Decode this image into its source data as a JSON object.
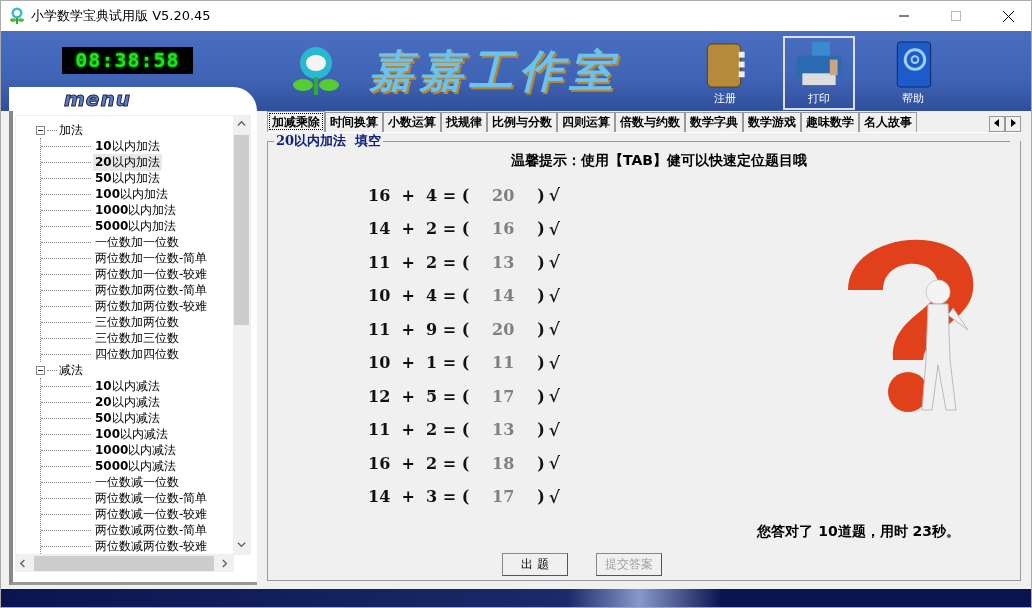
{
  "window": {
    "title": "小学数学宝典试用版  V5.20.45"
  },
  "header": {
    "clock": "08:38:58",
    "logo_text": "嘉嘉工作室",
    "toolbar": [
      {
        "label": "注册",
        "kind": "notebook",
        "selected": false
      },
      {
        "label": "打印",
        "kind": "printer",
        "selected": true
      },
      {
        "label": "帮助",
        "kind": "addressbook",
        "selected": false
      }
    ]
  },
  "sidebar": {
    "title": "menu",
    "tree": [
      {
        "label": "加法",
        "expanded": true,
        "children": [
          {
            "label": "**10**以内加法",
            "selected": false
          },
          {
            "label": "**20**以内加法",
            "selected": true
          },
          {
            "label": "**50**以内加法",
            "selected": false
          },
          {
            "label": "**100**以内加法",
            "selected": false
          },
          {
            "label": "**1000**以内加法",
            "selected": false
          },
          {
            "label": "**5000**以内加法",
            "selected": false
          },
          {
            "label": "一位数加一位数",
            "selected": false
          },
          {
            "label": "两位数加一位数-简单",
            "selected": false
          },
          {
            "label": "两位数加一位数-较难",
            "selected": false
          },
          {
            "label": "两位数加两位数-简单",
            "selected": false
          },
          {
            "label": "两位数加两位数-较难",
            "selected": false
          },
          {
            "label": "三位数加两位数",
            "selected": false
          },
          {
            "label": "三位数加三位数",
            "selected": false
          },
          {
            "label": "四位数加四位数",
            "selected": false
          }
        ]
      },
      {
        "label": "减法",
        "expanded": true,
        "children": [
          {
            "label": "**10**以内减法",
            "selected": false
          },
          {
            "label": "**20**以内减法",
            "selected": false
          },
          {
            "label": "**50**以内减法",
            "selected": false
          },
          {
            "label": "**100**以内减法",
            "selected": false
          },
          {
            "label": "**1000**以内减法",
            "selected": false
          },
          {
            "label": "**5000**以内减法",
            "selected": false
          },
          {
            "label": "一位数减一位数",
            "selected": false
          },
          {
            "label": "两位数减一位数-简单",
            "selected": false
          },
          {
            "label": "两位数减一位数-较难",
            "selected": false
          },
          {
            "label": "两位数减两位数-简单",
            "selected": false
          },
          {
            "label": "两位数减两位数-较难",
            "selected": false
          }
        ]
      }
    ]
  },
  "tabs": [
    {
      "label": "加减乘除",
      "selected": true
    },
    {
      "label": "时间换算",
      "selected": false
    },
    {
      "label": "小数运算",
      "selected": false
    },
    {
      "label": "找规律",
      "selected": false
    },
    {
      "label": "比例与分数",
      "selected": false
    },
    {
      "label": "四则运算",
      "selected": false
    },
    {
      "label": "倍数与约数",
      "selected": false
    },
    {
      "label": "数学字典",
      "selected": false
    },
    {
      "label": "数学游戏",
      "selected": false
    },
    {
      "label": "趣味数学",
      "selected": false
    },
    {
      "label": "名人故事",
      "selected": false
    }
  ],
  "exercise": {
    "title": "20以内加法  填空",
    "hint": "温馨提示：使用【TAB】健可以快速定位题目哦",
    "problems": [
      {
        "question": "16  +  4 = (",
        "answer": "20",
        "closing": ")",
        "result": "√"
      },
      {
        "question": "14  +  2 = (",
        "answer": "16",
        "closing": ")",
        "result": "√"
      },
      {
        "question": "11  +  2 = (",
        "answer": "13",
        "closing": ")",
        "result": "√"
      },
      {
        "question": "10  +  4 = (",
        "answer": "14",
        "closing": ")",
        "result": "√"
      },
      {
        "question": "11  +  9 = (",
        "answer": "20",
        "closing": ")",
        "result": "√"
      },
      {
        "question": "10  +  1 = (",
        "answer": "11",
        "closing": ")",
        "result": "√"
      },
      {
        "question": "12  +  5 = (",
        "answer": "17",
        "closing": ")",
        "result": "√"
      },
      {
        "question": "11  +  2 = (",
        "answer": "13",
        "closing": ")",
        "result": "√"
      },
      {
        "question": "16  +  2 = (",
        "answer": "18",
        "closing": ")",
        "result": "√"
      },
      {
        "question": "14  +  3 = (",
        "answer": "17",
        "closing": ")",
        "result": "√"
      }
    ],
    "summary": "您答对了 **10**道题，用时 **23**秒。",
    "buttons": [
      {
        "label": "出 题",
        "disabled": false
      },
      {
        "label": "提交答案",
        "disabled": true
      }
    ]
  }
}
